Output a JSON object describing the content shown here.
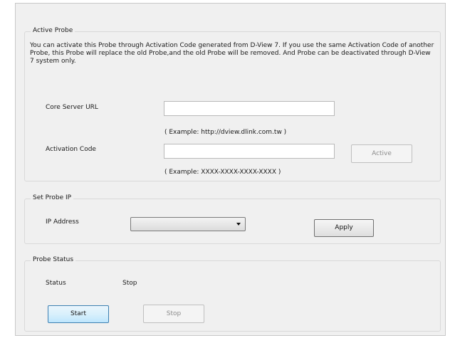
{
  "active_probe": {
    "title": "Active Probe",
    "description": "You can activate this Probe through Activation Code generated from D-View 7. If you use the same Activation Code of another Probe, this Probe will replace the old Probe,and the old Probe will be removed. And Probe can be deactivated through D-View 7 system only.",
    "core_server_url_label": "Core Server URL",
    "core_server_url_value": "",
    "core_server_url_example": "( Example: http://dview.dlink.com.tw )",
    "activation_code_label": "Activation Code",
    "activation_code_value": "",
    "activation_code_example": "( Example: XXXX-XXXX-XXXX-XXXX )",
    "active_button": "Active"
  },
  "set_probe_ip": {
    "title": "Set Probe IP",
    "ip_address_label": "IP Address",
    "ip_address_selected": "",
    "apply_button": "Apply"
  },
  "probe_status": {
    "title": "Probe Status",
    "status_label": "Status",
    "status_value": "Stop",
    "start_button": "Start",
    "stop_button": "Stop"
  }
}
